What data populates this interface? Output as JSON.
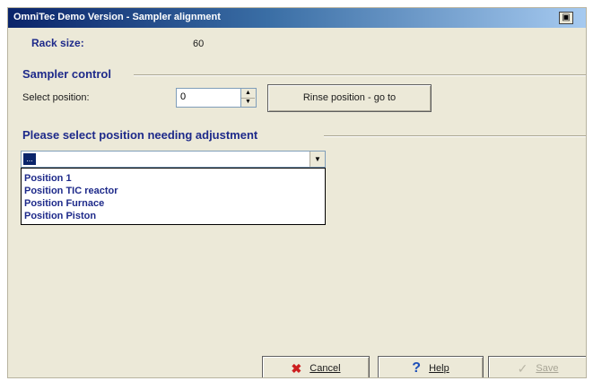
{
  "window": {
    "title": "OmniTec Demo Version - Sampler alignment"
  },
  "rack": {
    "label": "Rack size:",
    "value": "60"
  },
  "sampler_control": {
    "heading": "Sampler control",
    "position_label": "Select position:",
    "position_value": "0",
    "go_button": "Rinse position - go to"
  },
  "adjustment": {
    "heading": "Please select position needing adjustment",
    "selected": "...",
    "options": [
      "Position 1",
      "Position TIC reactor",
      "Position Furnace",
      "Position Piston"
    ]
  },
  "footer": {
    "cancel_label": "Cancel",
    "help_label": "Help",
    "save_label": "Save"
  },
  "colors": {
    "heading": "#1e2a8a",
    "titlebar": "#0a246a",
    "cancel_x": "#cc1f1f",
    "help_q": "#1d4fb8"
  }
}
